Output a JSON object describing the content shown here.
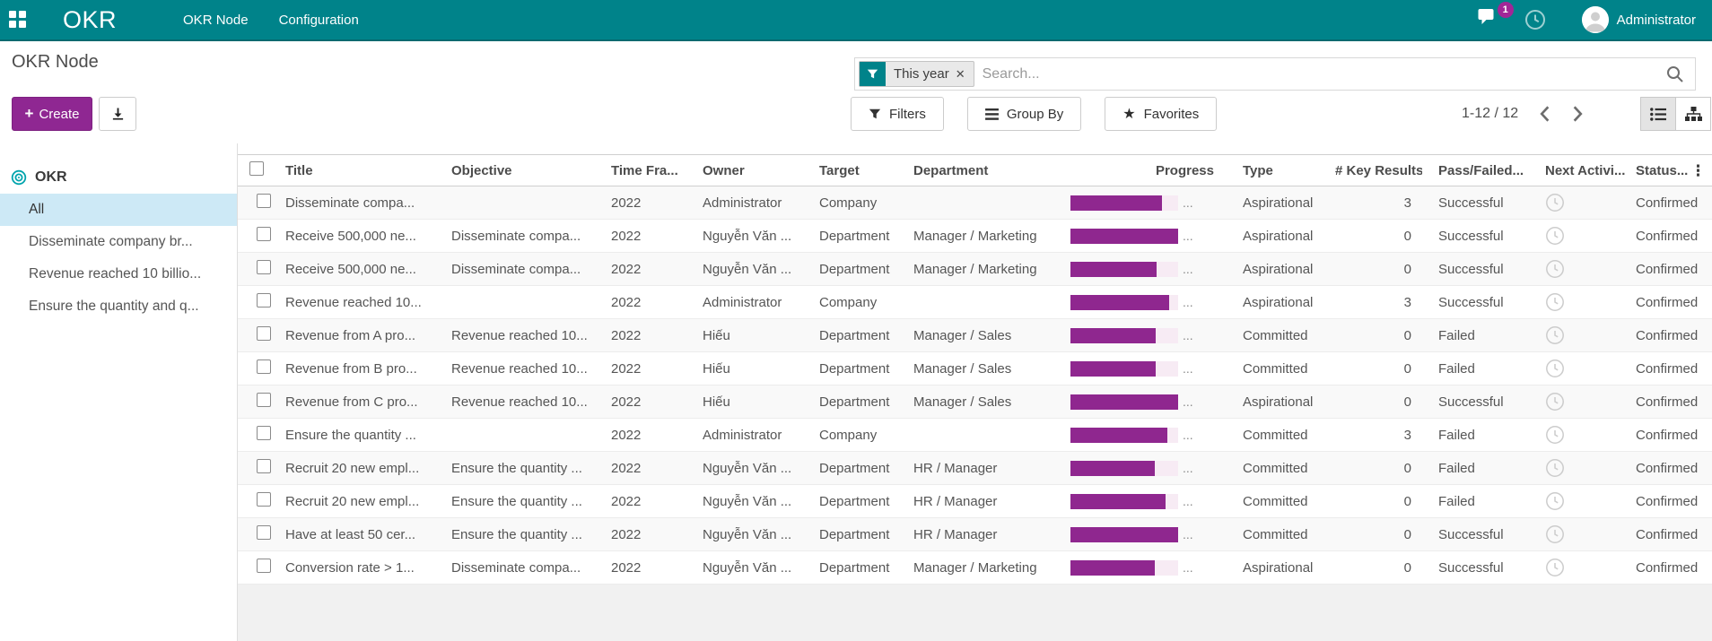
{
  "navbar": {
    "brand": "OKR",
    "menus": [
      {
        "label": "OKR Node"
      },
      {
        "label": "Configuration"
      }
    ],
    "message_count": "1",
    "user_name": "Administrator"
  },
  "control_panel": {
    "breadcrumb": "OKR Node",
    "create_plus": "+",
    "create_label": "Create",
    "search": {
      "facet_label": "This year",
      "facet_remove": "✕",
      "placeholder": "Search..."
    },
    "filters_label": "Filters",
    "group_by_label": "Group By",
    "favorites_label": "Favorites",
    "favorites_star": "★",
    "pager_text": "1-12 / 12",
    "kebab_glyph": "⋮"
  },
  "sidebar": {
    "root_label": "OKR",
    "selected_index": 0,
    "items": [
      "All",
      "Disseminate company br...",
      "Revenue reached 10 billio...",
      "Ensure the quantity and q..."
    ]
  },
  "table": {
    "headers": [
      "Title",
      "Objective",
      "Time Fra...",
      "Owner",
      "Target",
      "Department",
      "Progress",
      "Type",
      "# Key Results",
      "Pass/Failed...",
      "Next Activi...",
      "Status..."
    ],
    "progress_text": "...",
    "rows": [
      {
        "title": "Disseminate compa...",
        "objective": "",
        "time_frame": "2022",
        "owner": "Administrator",
        "target": "Company",
        "department": "",
        "progress_pct": 85,
        "type": "Aspirational",
        "key_results": "3",
        "pass_failed": "Successful",
        "status": "Confirmed"
      },
      {
        "title": "Receive 500,000 ne...",
        "objective": "Disseminate compa...",
        "time_frame": "2022",
        "owner": "Nguyễn Văn ...",
        "target": "Department",
        "department": "Manager / Marketing",
        "progress_pct": 100,
        "type": "Aspirational",
        "key_results": "0",
        "pass_failed": "Successful",
        "status": "Confirmed"
      },
      {
        "title": "Receive 500,000 ne...",
        "objective": "Disseminate compa...",
        "time_frame": "2022",
        "owner": "Nguyễn Văn ...",
        "target": "Department",
        "department": "Manager / Marketing",
        "progress_pct": 80,
        "type": "Aspirational",
        "key_results": "0",
        "pass_failed": "Successful",
        "status": "Confirmed"
      },
      {
        "title": "Revenue reached 10...",
        "objective": "",
        "time_frame": "2022",
        "owner": "Administrator",
        "target": "Company",
        "department": "",
        "progress_pct": 92,
        "type": "Aspirational",
        "key_results": "3",
        "pass_failed": "Successful",
        "status": "Confirmed"
      },
      {
        "title": "Revenue from A pro...",
        "objective": "Revenue reached 10...",
        "time_frame": "2022",
        "owner": "Hiếu",
        "target": "Department",
        "department": "Manager / Sales",
        "progress_pct": 79,
        "type": "Committed",
        "key_results": "0",
        "pass_failed": "Failed",
        "status": "Confirmed"
      },
      {
        "title": "Revenue from B pro...",
        "objective": "Revenue reached 10...",
        "time_frame": "2022",
        "owner": "Hiếu",
        "target": "Department",
        "department": "Manager / Sales",
        "progress_pct": 79,
        "type": "Committed",
        "key_results": "0",
        "pass_failed": "Failed",
        "status": "Confirmed"
      },
      {
        "title": "Revenue from C pro...",
        "objective": "Revenue reached 10...",
        "time_frame": "2022",
        "owner": "Hiếu",
        "target": "Department",
        "department": "Manager / Sales",
        "progress_pct": 100,
        "type": "Aspirational",
        "key_results": "0",
        "pass_failed": "Successful",
        "status": "Confirmed"
      },
      {
        "title": "Ensure the quantity ...",
        "objective": "",
        "time_frame": "2022",
        "owner": "Administrator",
        "target": "Company",
        "department": "",
        "progress_pct": 90,
        "type": "Committed",
        "key_results": "3",
        "pass_failed": "Failed",
        "status": "Confirmed"
      },
      {
        "title": "Recruit 20 new empl...",
        "objective": "Ensure the quantity ...",
        "time_frame": "2022",
        "owner": "Nguyễn Văn ...",
        "target": "Department",
        "department": "HR / Manager",
        "progress_pct": 78,
        "type": "Committed",
        "key_results": "0",
        "pass_failed": "Failed",
        "status": "Confirmed"
      },
      {
        "title": "Recruit 20 new empl...",
        "objective": "Ensure the quantity ...",
        "time_frame": "2022",
        "owner": "Nguyễn Văn ...",
        "target": "Department",
        "department": "HR / Manager",
        "progress_pct": 88,
        "type": "Committed",
        "key_results": "0",
        "pass_failed": "Failed",
        "status": "Confirmed"
      },
      {
        "title": "Have at least 50 cer...",
        "objective": "Ensure the quantity ...",
        "time_frame": "2022",
        "owner": "Nguyễn Văn ...",
        "target": "Department",
        "department": "HR / Manager",
        "progress_pct": 100,
        "type": "Committed",
        "key_results": "0",
        "pass_failed": "Successful",
        "status": "Confirmed"
      },
      {
        "title": "Conversion rate > 1...",
        "objective": "Disseminate compa...",
        "time_frame": "2022",
        "owner": "Nguyễn Văn ...",
        "target": "Department",
        "department": "Manager / Marketing",
        "progress_pct": 78,
        "type": "Aspirational",
        "key_results": "0",
        "pass_failed": "Successful",
        "status": "Confirmed"
      }
    ]
  },
  "icons": {
    "apps": "grid",
    "messages": "chat-bubble",
    "activities": "clock",
    "avatar": "person",
    "facet": "funnel",
    "remove_facet": "x",
    "search": "magnifier",
    "filters": "funnel",
    "group_by": "bars",
    "favorites": "star",
    "export": "download",
    "prev": "chevron-left",
    "next": "chevron-right",
    "list_view": "list",
    "hierarchy_view": "sitemap",
    "okr_root": "bullseye",
    "next_activity": "clock",
    "column_options": "vertical-dots"
  },
  "colors": {
    "navbar_bg": "#00838a",
    "navbar_border": "#056a6f",
    "primary_magenta": "#8f2792",
    "progress_fill": "#8f278f",
    "progress_track": "#f7ebf4",
    "badge_bg": "#a12697",
    "sidebar_selected_bg": "#cde9f6",
    "row_alt_bg": "#f9f9f9",
    "below_table_bg": "#f1f1f1"
  }
}
